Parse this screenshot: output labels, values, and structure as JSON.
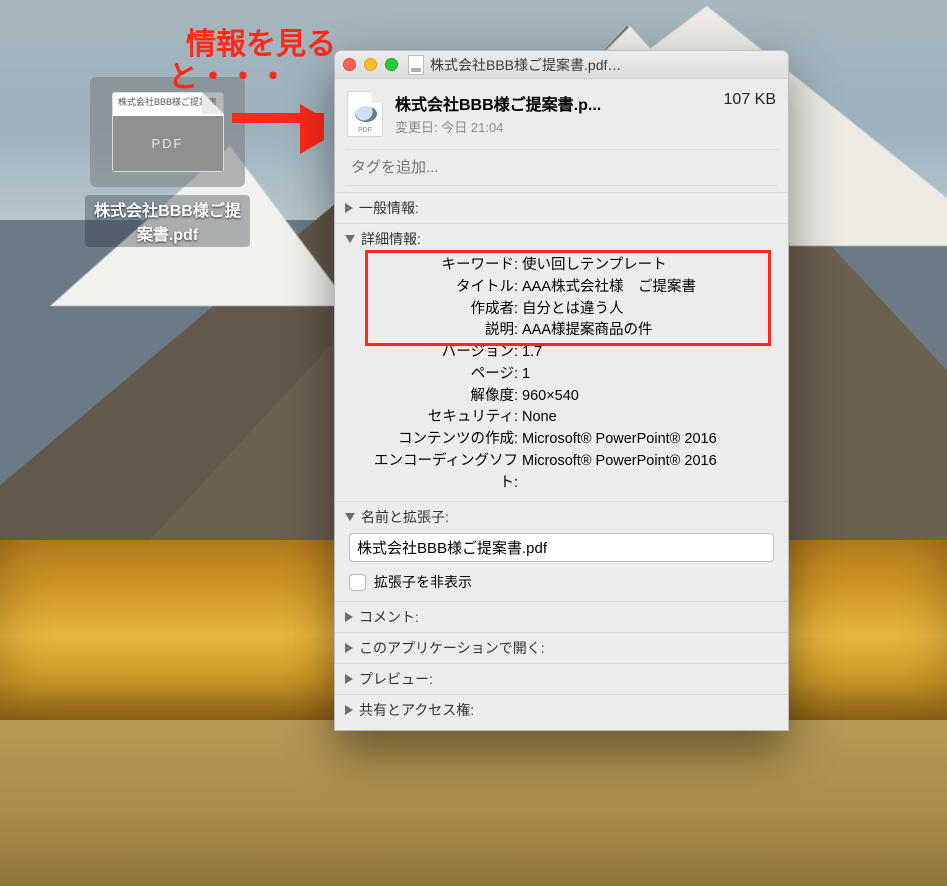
{
  "annotation": {
    "line1": "情報を見る",
    "line2": "と・・・"
  },
  "desktop_file": {
    "label": "株式会社BBB様ご提案書.pdf",
    "thumb_text": "株式会社BBB様ご提案書",
    "thumb_badge": "PDF"
  },
  "window": {
    "title": "株式会社BBB様ご提案書.pdf…",
    "header": {
      "name": "株式会社BBB様ご提案書.p...",
      "size": "107 KB",
      "modified_label": "変更日:",
      "modified_value": "今日 21:04",
      "pdf_badge": "PDF"
    },
    "tags_placeholder": "タグを追加...",
    "sections": {
      "general": {
        "label": "一般情報:"
      },
      "detail": {
        "label": "詳細情報:",
        "rows": [
          {
            "k": "キーワード:",
            "v": "使い回しテンプレート"
          },
          {
            "k": "タイトル:",
            "v": "AAA株式会社様　ご提案書"
          },
          {
            "k": "作成者:",
            "v": "自分とは違う人"
          },
          {
            "k": "説明:",
            "v": "AAA様提案商品の件"
          },
          {
            "k": "バージョン:",
            "v": "1.7"
          },
          {
            "k": "ページ:",
            "v": "1"
          },
          {
            "k": "解像度:",
            "v": "960×540"
          },
          {
            "k": "セキュリティ:",
            "v": "None"
          },
          {
            "k": "コンテンツの作成:",
            "v": "Microsoft® PowerPoint® 2016"
          },
          {
            "k": "エンコーディングソフト:",
            "v": "Microsoft® PowerPoint® 2016"
          }
        ]
      },
      "name_ext": {
        "label": "名前と拡張子:",
        "filename": "株式会社BBB様ご提案書.pdf",
        "hide_ext": "拡張子を非表示"
      },
      "comment": {
        "label": "コメント:"
      },
      "open_with": {
        "label": "このアプリケーションで開く:"
      },
      "preview": {
        "label": "プレビュー:"
      },
      "sharing": {
        "label": "共有とアクセス権:"
      }
    }
  }
}
